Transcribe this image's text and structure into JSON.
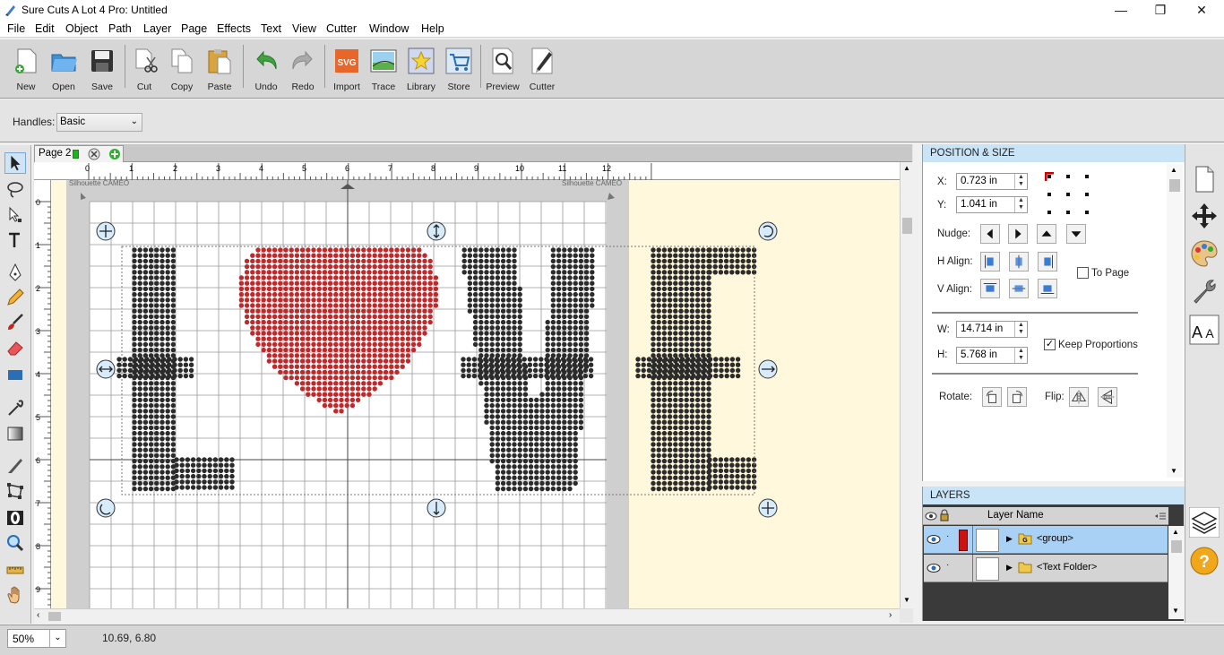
{
  "window": {
    "title": "Sure Cuts A Lot 4 Pro: Untitled",
    "controls": {
      "minimize": "—",
      "maximize": "❐",
      "close": "✕"
    }
  },
  "menu": [
    "File",
    "Edit",
    "Object",
    "Path",
    "Layer",
    "Page",
    "Effects",
    "Text",
    "View",
    "Cutter",
    "Window",
    "Help"
  ],
  "toolbar": [
    {
      "label": "New",
      "icon": "new-document-icon"
    },
    {
      "label": "Open",
      "icon": "open-folder-icon"
    },
    {
      "label": "Save",
      "icon": "floppy-disk-icon"
    },
    {
      "label": "Cut",
      "icon": "scissors-icon"
    },
    {
      "label": "Copy",
      "icon": "copy-icon"
    },
    {
      "label": "Paste",
      "icon": "clipboard-icon"
    },
    {
      "label": "Undo",
      "icon": "undo-arrow-icon"
    },
    {
      "label": "Redo",
      "icon": "redo-arrow-icon"
    },
    {
      "label": "Import",
      "icon": "svg-import-icon"
    },
    {
      "label": "Trace",
      "icon": "image-trace-icon"
    },
    {
      "label": "Library",
      "icon": "star-library-icon"
    },
    {
      "label": "Store",
      "icon": "shopping-cart-icon"
    },
    {
      "label": "Preview",
      "icon": "magnifier-preview-icon"
    },
    {
      "label": "Cutter",
      "icon": "cutter-pen-icon"
    }
  ],
  "handles": {
    "label": "Handles:",
    "value": "Basic"
  },
  "page_tab": {
    "label": "Page 2"
  },
  "ruler": {
    "h_ticks": [
      "0",
      "1",
      "2",
      "3",
      "4",
      "5",
      "6",
      "7",
      "8",
      "9",
      "10",
      "11",
      "12"
    ],
    "v_ticks": [
      "0",
      "1",
      "2",
      "3",
      "4",
      "5",
      "6",
      "7",
      "8",
      "9"
    ]
  },
  "mat_label": "Silhouette CAMEO",
  "design_text": [
    "L",
    "heart",
    "V",
    "E"
  ],
  "colors": {
    "rhinestone_dark": "#2b2b2b",
    "rhinestone_red": "#c0282a",
    "panel_header": "#c9e4f6",
    "selected_layer": "#a9d1f5"
  },
  "position_size": {
    "header": "POSITION & SIZE",
    "x_label": "X:",
    "x_value": "0.723 in",
    "y_label": "Y:",
    "y_value": "1.041 in",
    "nudge_label": "Nudge:",
    "halign_label": "H Align:",
    "valign_label": "V Align:",
    "to_page_label": "To Page",
    "w_label": "W:",
    "w_value": "14.714 in",
    "h_label": "H:",
    "h_value": "5.768 in",
    "keep_proportions_label": "Keep Proportions",
    "keep_proportions_checked": true,
    "rotate_label": "Rotate:",
    "flip_label": "Flip:"
  },
  "layers": {
    "header": "LAYERS",
    "column": "Layer Name",
    "rows": [
      {
        "name": "<group>",
        "color": "#cc1111",
        "selected": true
      },
      {
        "name": "<Text Folder>",
        "color": "",
        "selected": false
      }
    ]
  },
  "status": {
    "zoom": "50%",
    "coords": "10.69, 6.80"
  }
}
